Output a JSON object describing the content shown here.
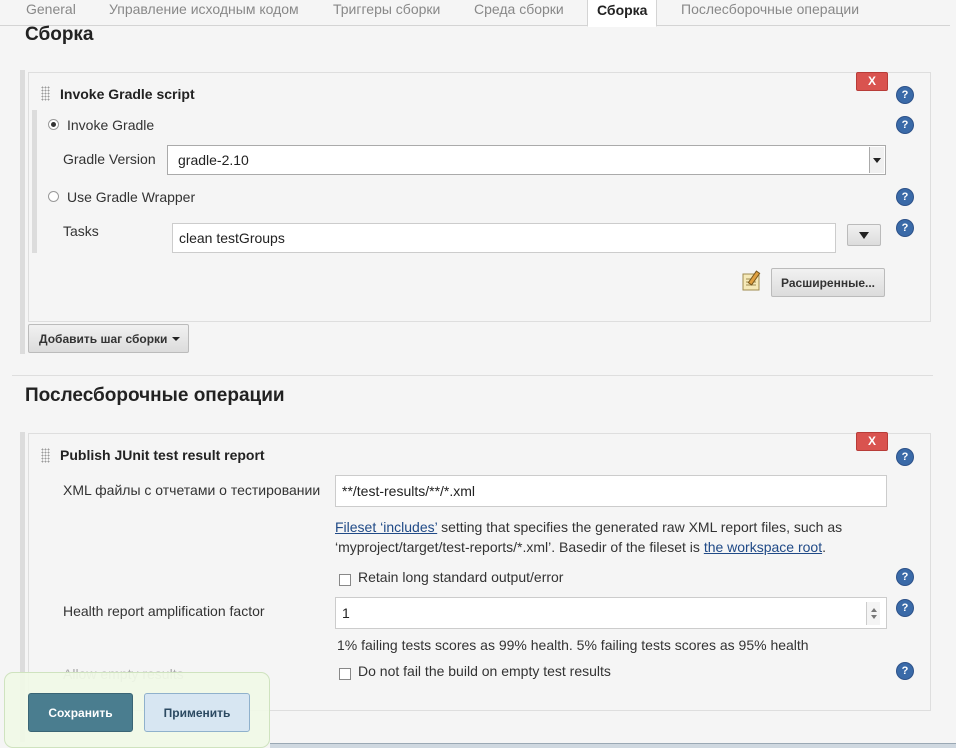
{
  "tabs": [
    "General",
    "Управление исходным кодом",
    "Триггеры сборки",
    "Среда сборки",
    "Сборка",
    "Послесборочные операции"
  ],
  "build": {
    "title": "Сборка",
    "step_title": "Invoke Gradle script",
    "delete_label": "X",
    "help_label": "?",
    "invoke_gradle_label": "Invoke Gradle",
    "gradle_version_label": "Gradle Version",
    "gradle_version_value": "gradle-2.10",
    "use_wrapper_label": "Use Gradle Wrapper",
    "tasks_label": "Tasks",
    "tasks_value": "clean testGroups",
    "advanced_label": "Расширенные...",
    "add_step_label": "Добавить шаг сборки"
  },
  "post": {
    "title": "Послесборочные операции",
    "step_title": "Publish JUnit test result report",
    "delete_label": "X",
    "xml_label": "XML файлы с отчетами о тестировании",
    "xml_value": "**/test-results/**/*.xml",
    "fileset_link": "Fileset ‘includes’",
    "fileset_text_1": " setting that specifies the generated raw XML report files, such as ‘myproject/target/test-reports/*.xml’. Basedir of the fileset is ",
    "workspace_link": "the workspace root",
    "fileset_text_2": ".",
    "retain_label": "Retain long standard output/error",
    "health_label": "Health report amplification factor",
    "health_value": "1",
    "health_hint": "1% failing tests scores as 99% health. 5% failing tests scores as 95% health",
    "allow_empty_label": "Allow empty results",
    "no_fail_label": "Do not fail the build on empty test results"
  },
  "footer": {
    "save_label": "Сохранить",
    "apply_label": "Применить"
  }
}
